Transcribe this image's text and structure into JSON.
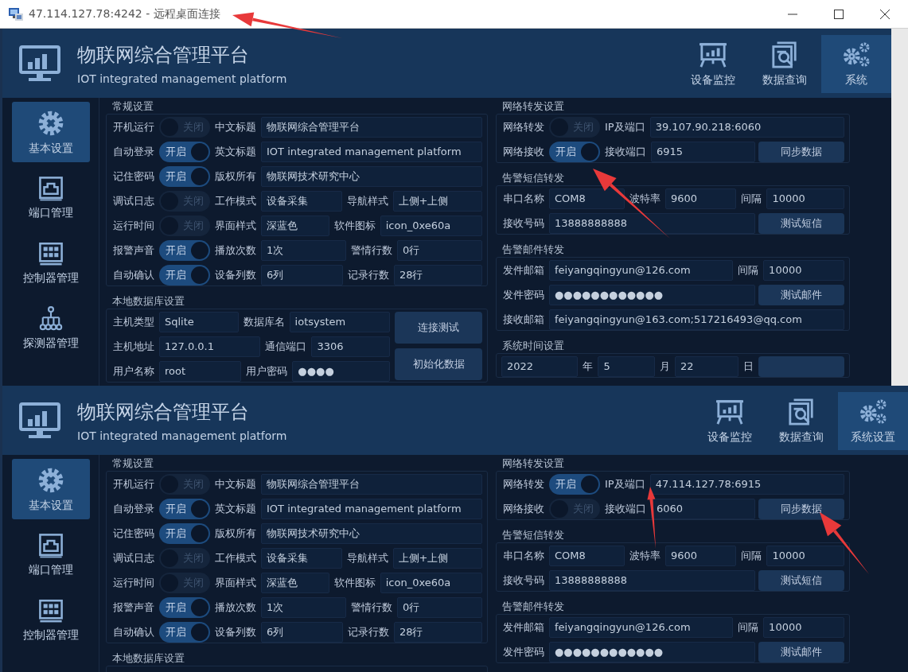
{
  "titlebar": {
    "title": "47.114.127.78:4242 - 远程桌面连接"
  },
  "panels": [
    {
      "title": "物联网综合管理平台",
      "subtitle": "IOT integrated management platform",
      "nav": [
        {
          "label": "设备监控",
          "kind": "monitor",
          "selected": false
        },
        {
          "label": "数据查询",
          "kind": "query",
          "selected": false
        },
        {
          "label": "系统",
          "kind": "settings",
          "selected": true
        }
      ],
      "sidebar": [
        {
          "label": "基本设置",
          "kind": "settings",
          "selected": true
        },
        {
          "label": "端口管理",
          "kind": "port",
          "selected": false
        },
        {
          "label": "控制器管理",
          "kind": "controller",
          "selected": false
        },
        {
          "label": "探测器管理",
          "kind": "detector",
          "selected": false
        }
      ],
      "left_groups": [
        {
          "title": "常规设置",
          "rows": [
            [
              {
                "kind": "label",
                "text": "开机运行"
              },
              {
                "kind": "toggle",
                "text": "关闭",
                "on": false
              },
              {
                "kind": "label",
                "text": "中文标题"
              },
              {
                "kind": "field",
                "value": "物联网综合管理平台"
              }
            ],
            [
              {
                "kind": "label",
                "text": "自动登录"
              },
              {
                "kind": "toggle",
                "text": "开启",
                "on": true
              },
              {
                "kind": "label",
                "text": "英文标题"
              },
              {
                "kind": "field",
                "value": "IOT integrated management platform"
              }
            ],
            [
              {
                "kind": "label",
                "text": "记住密码"
              },
              {
                "kind": "toggle",
                "text": "开启",
                "on": true
              },
              {
                "kind": "label",
                "text": "版权所有"
              },
              {
                "kind": "field",
                "value": "物联网技术研究中心"
              }
            ],
            [
              {
                "kind": "label",
                "text": "调试日志"
              },
              {
                "kind": "toggle",
                "text": "关闭",
                "on": false
              },
              {
                "kind": "label",
                "text": "工作模式"
              },
              {
                "kind": "field",
                "value": "设备采集"
              },
              {
                "kind": "label",
                "text": "导航样式"
              },
              {
                "kind": "field",
                "value": "上侧+上侧"
              }
            ],
            [
              {
                "kind": "label",
                "text": "运行时间"
              },
              {
                "kind": "toggle",
                "text": "关闭",
                "on": false
              },
              {
                "kind": "label",
                "text": "界面样式"
              },
              {
                "kind": "field",
                "value": "深蓝色"
              },
              {
                "kind": "label",
                "text": "软件图标"
              },
              {
                "kind": "field",
                "value": "icon_0xe60a"
              }
            ],
            [
              {
                "kind": "label",
                "text": "报警声音"
              },
              {
                "kind": "toggle",
                "text": "开启",
                "on": true
              },
              {
                "kind": "label",
                "text": "播放次数"
              },
              {
                "kind": "field",
                "value": "1次"
              },
              {
                "kind": "label",
                "text": "警情行数"
              },
              {
                "kind": "field",
                "value": "0行"
              }
            ],
            [
              {
                "kind": "label",
                "text": "自动确认"
              },
              {
                "kind": "toggle",
                "text": "开启",
                "on": true
              },
              {
                "kind": "label",
                "text": "设备列数"
              },
              {
                "kind": "field",
                "value": "6列"
              },
              {
                "kind": "label",
                "text": "记录行数"
              },
              {
                "kind": "field",
                "value": "28行"
              }
            ]
          ]
        },
        {
          "title": "本地数据库设置",
          "rows": [
            [
              {
                "kind": "label",
                "text": "主机类型"
              },
              {
                "kind": "field",
                "value": "Sqlite"
              },
              {
                "kind": "label",
                "text": "数据库名"
              },
              {
                "kind": "field",
                "value": "iotsystem"
              }
            ],
            [
              {
                "kind": "label",
                "text": "主机地址"
              },
              {
                "kind": "field",
                "value": "127.0.0.1"
              },
              {
                "kind": "label",
                "text": "通信端口"
              },
              {
                "kind": "field",
                "value": "3306"
              }
            ],
            [
              {
                "kind": "label",
                "text": "用户名称"
              },
              {
                "kind": "field",
                "value": "root"
              },
              {
                "kind": "label",
                "text": "用户密码"
              },
              {
                "kind": "field",
                "value": "●●●●"
              }
            ]
          ],
          "buttons": [
            "连接测试",
            "初始化数据"
          ]
        }
      ],
      "right_groups": [
        {
          "title": "网络转发设置",
          "rows": [
            [
              {
                "kind": "label",
                "text": "网络转发"
              },
              {
                "kind": "toggle",
                "text": "关闭",
                "on": false
              },
              {
                "kind": "label",
                "text": "IP及端口"
              },
              {
                "kind": "field",
                "value": "39.107.90.218:6060"
              }
            ],
            [
              {
                "kind": "label",
                "text": "网络接收"
              },
              {
                "kind": "toggle",
                "text": "开启",
                "on": true
              },
              {
                "kind": "label",
                "text": "接收端口"
              },
              {
                "kind": "field",
                "value": "6915"
              },
              {
                "kind": "button",
                "label": "同步数据"
              }
            ]
          ]
        },
        {
          "title": "告警短信转发",
          "rows": [
            [
              {
                "kind": "label",
                "text": "串口名称"
              },
              {
                "kind": "field",
                "value": "COM8"
              },
              {
                "kind": "label",
                "text": "波特率"
              },
              {
                "kind": "field",
                "value": "9600"
              },
              {
                "kind": "label",
                "text": "间隔"
              },
              {
                "kind": "field",
                "value": "10000"
              }
            ],
            [
              {
                "kind": "label",
                "text": "接收号码"
              },
              {
                "kind": "field",
                "value": "13888888888"
              },
              "",
              "",
              "",
              {
                "kind": "button",
                "label": "测试短信"
              }
            ]
          ]
        },
        {
          "title": "告警邮件转发",
          "rows": [
            [
              {
                "kind": "label",
                "text": "发件邮箱"
              },
              {
                "kind": "field",
                "value": "feiyangqingyun@126.com"
              },
              {
                "kind": "label",
                "text": "间隔"
              },
              {
                "kind": "field",
                "value": "10000"
              }
            ],
            [
              {
                "kind": "label",
                "text": "发件密码"
              },
              {
                "kind": "field",
                "value": "●●●●●●●●●●●●"
              },
              "",
              {
                "kind": "button",
                "label": "测试邮件"
              }
            ],
            [
              {
                "kind": "label",
                "text": "接收邮箱"
              },
              {
                "kind": "field",
                "value": "feiyangqingyun@163.com;517216493@qq.com"
              }
            ]
          ]
        },
        {
          "title": "系统时间设置",
          "rows": [
            [
              {
                "kind": "field",
                "value": "2022"
              },
              {
                "kind": "label",
                "text": "年"
              },
              {
                "kind": "field",
                "value": "5"
              },
              {
                "kind": "label",
                "text": "月"
              },
              {
                "kind": "field",
                "value": "22"
              },
              {
                "kind": "label",
                "text": "日"
              },
              {
                "kind": "button"
              }
            ]
          ]
        }
      ]
    },
    {
      "title": "物联网综合管理平台",
      "subtitle": "IOT integrated management platform",
      "nav": [
        {
          "label": "设备监控",
          "kind": "monitor",
          "selected": false
        },
        {
          "label": "数据查询",
          "kind": "query",
          "selected": false
        },
        {
          "label": "系统设置",
          "kind": "settings",
          "selected": true
        }
      ],
      "sidebar": [
        {
          "label": "基本设置",
          "kind": "settings",
          "selected": true
        },
        {
          "label": "端口管理",
          "kind": "port",
          "selected": false
        },
        {
          "label": "控制器管理",
          "kind": "controller",
          "selected": false
        }
      ],
      "left_groups": [
        {
          "title": "常规设置",
          "rows": [
            [
              {
                "kind": "label",
                "text": "开机运行"
              },
              {
                "kind": "toggle",
                "text": "关闭",
                "on": false
              },
              {
                "kind": "label",
                "text": "中文标题"
              },
              {
                "kind": "field",
                "value": "物联网综合管理平台"
              }
            ],
            [
              {
                "kind": "label",
                "text": "自动登录"
              },
              {
                "kind": "toggle",
                "text": "开启",
                "on": true
              },
              {
                "kind": "label",
                "text": "英文标题"
              },
              {
                "kind": "field",
                "value": "IOT integrated management platform"
              }
            ],
            [
              {
                "kind": "label",
                "text": "记住密码"
              },
              {
                "kind": "toggle",
                "text": "开启",
                "on": true
              },
              {
                "kind": "label",
                "text": "版权所有"
              },
              {
                "kind": "field",
                "value": "物联网技术研究中心"
              }
            ],
            [
              {
                "kind": "label",
                "text": "调试日志"
              },
              {
                "kind": "toggle",
                "text": "关闭",
                "on": false
              },
              {
                "kind": "label",
                "text": "工作模式"
              },
              {
                "kind": "field",
                "value": "设备采集"
              },
              {
                "kind": "label",
                "text": "导航样式"
              },
              {
                "kind": "field",
                "value": "上侧+上侧"
              }
            ],
            [
              {
                "kind": "label",
                "text": "运行时间"
              },
              {
                "kind": "toggle",
                "text": "关闭",
                "on": false
              },
              {
                "kind": "label",
                "text": "界面样式"
              },
              {
                "kind": "field",
                "value": "深蓝色"
              },
              {
                "kind": "label",
                "text": "软件图标"
              },
              {
                "kind": "field",
                "value": "icon_0xe60a"
              }
            ],
            [
              {
                "kind": "label",
                "text": "报警声音"
              },
              {
                "kind": "toggle",
                "text": "开启",
                "on": true
              },
              {
                "kind": "label",
                "text": "播放次数"
              },
              {
                "kind": "field",
                "value": "1次"
              },
              {
                "kind": "label",
                "text": "警情行数"
              },
              {
                "kind": "field",
                "value": "0行"
              }
            ],
            [
              {
                "kind": "label",
                "text": "自动确认"
              },
              {
                "kind": "toggle",
                "text": "开启",
                "on": true
              },
              {
                "kind": "label",
                "text": "设备列数"
              },
              {
                "kind": "field",
                "value": "6列"
              },
              {
                "kind": "label",
                "text": "记录行数"
              },
              {
                "kind": "field",
                "value": "28行"
              }
            ]
          ]
        },
        {
          "title": "本地数据库设置"
        }
      ],
      "right_groups": [
        {
          "title": "网络转发设置",
          "rows": [
            [
              {
                "kind": "label",
                "text": "网络转发"
              },
              {
                "kind": "toggle",
                "text": "开启",
                "on": true
              },
              {
                "kind": "label",
                "text": "IP及端口"
              },
              {
                "kind": "field",
                "value": "47.114.127.78:6915"
              }
            ],
            [
              {
                "kind": "label",
                "text": "网络接收"
              },
              {
                "kind": "toggle",
                "text": "关闭",
                "on": false
              },
              {
                "kind": "label",
                "text": "接收端口"
              },
              {
                "kind": "field",
                "value": "6060"
              },
              {
                "kind": "button",
                "label": "同步数据"
              }
            ]
          ]
        },
        {
          "title": "告警短信转发",
          "rows": [
            [
              {
                "kind": "label",
                "text": "串口名称"
              },
              {
                "kind": "field",
                "value": "COM8"
              },
              {
                "kind": "label",
                "text": "波特率"
              },
              {
                "kind": "field",
                "value": "9600"
              },
              {
                "kind": "label",
                "text": "间隔"
              },
              {
                "kind": "field",
                "value": "10000"
              }
            ],
            [
              {
                "kind": "label",
                "text": "接收号码"
              },
              {
                "kind": "field",
                "value": "13888888888"
              },
              "",
              "",
              "",
              {
                "kind": "button",
                "label": "测试短信"
              }
            ]
          ]
        },
        {
          "title": "告警邮件转发",
          "rows": [
            [
              {
                "kind": "label",
                "text": "发件邮箱"
              },
              {
                "kind": "field",
                "value": "feiyangqingyun@126.com"
              },
              {
                "kind": "label",
                "text": "间隔"
              },
              {
                "kind": "field",
                "value": "10000"
              }
            ],
            [
              {
                "kind": "label",
                "text": "发件密码"
              },
              {
                "kind": "field",
                "value": "●●●●●●●●●●●●"
              },
              "",
              {
                "kind": "button",
                "label": "测试邮件"
              }
            ]
          ]
        }
      ]
    }
  ]
}
